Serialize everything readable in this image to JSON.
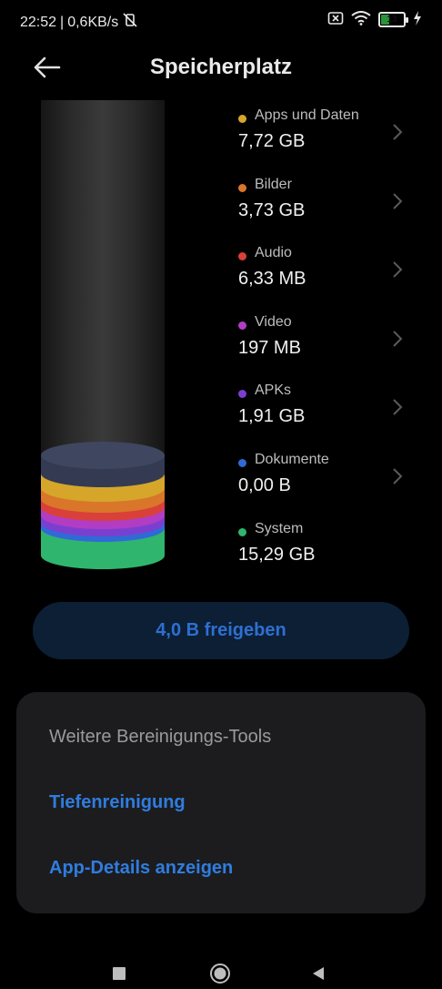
{
  "status_bar": {
    "time": "22:52",
    "separator": "|",
    "net_speed": "0,6KB/s",
    "battery_level": "13"
  },
  "header": {
    "title": "Speicherplatz"
  },
  "storage_categories": [
    {
      "label": "Apps und Daten",
      "value": "7,72 GB",
      "color": "#d6a62b"
    },
    {
      "label": "Bilder",
      "value": "3,73 GB",
      "color": "#d9762a"
    },
    {
      "label": "Audio",
      "value": "6,33 MB",
      "color": "#d9403a"
    },
    {
      "label": "Video",
      "value": "197 MB",
      "color": "#b13dc4"
    },
    {
      "label": "APKs",
      "value": "1,91 GB",
      "color": "#7b3fd0"
    },
    {
      "label": "Dokumente",
      "value": "0,00 B",
      "color": "#2f6ad6"
    },
    {
      "label": "System",
      "value": "15,29 GB",
      "color": "#2fb56e"
    }
  ],
  "free_button": {
    "label": "4,0 B freigeben"
  },
  "tools_card": {
    "title": "Weitere Bereinigungs-Tools",
    "links": [
      "Tiefenreinigung",
      "App-Details anzeigen"
    ]
  },
  "colors": {
    "accent": "#2f7de0",
    "free_button_bg": "#0c1f35",
    "card_bg": "#1c1c1e",
    "cylinder_cap": "#3f4660"
  }
}
